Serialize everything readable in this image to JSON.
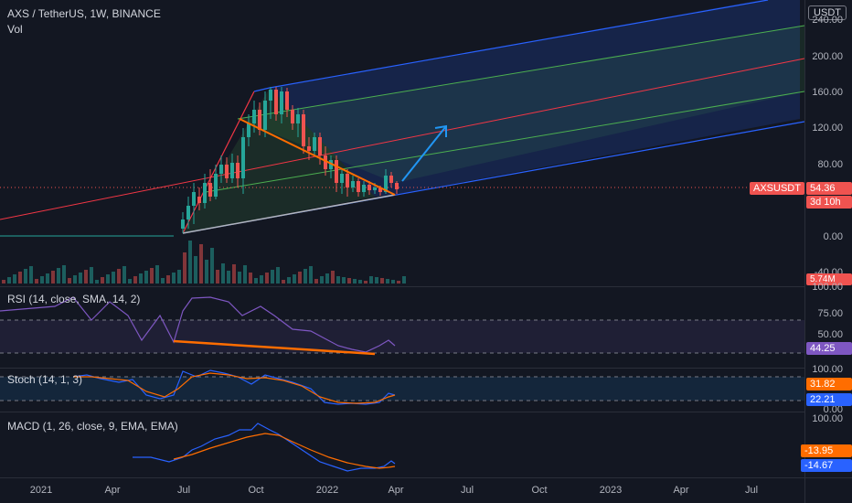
{
  "header": {
    "symbol": "AXS / TetherUS, 1W, BINANCE",
    "vol_label": "Vol"
  },
  "currency_badge": "USDT",
  "price_axis": [
    "240.00",
    "200.00",
    "160.00",
    "120.00",
    "80.00",
    "0.00",
    "-40.00"
  ],
  "price_tag": {
    "symbol": "AXSUSDT",
    "price": "54.36",
    "countdown": "3d 10h"
  },
  "volume_tag": "5.74M",
  "rsi": {
    "title": "RSI (14, close, SMA, 14, 2)",
    "axis": [
      "100.00",
      "75.00",
      "50.00"
    ],
    "value": "44.25"
  },
  "stoch": {
    "title": "Stoch (14, 1, 3)",
    "axis": [
      "100.00",
      "0.00"
    ],
    "values": [
      "31.82",
      "22.21"
    ]
  },
  "macd": {
    "title": "MACD (1, 26, close, 9, EMA, EMA)",
    "axis": [
      "100.00"
    ],
    "values": [
      "-13.95",
      "-14.67"
    ]
  },
  "time_axis": [
    "2021",
    "Apr",
    "Jul",
    "Oct",
    "2022",
    "Apr",
    "Jul",
    "Oct",
    "2023",
    "Apr",
    "Jul"
  ],
  "colors": {
    "background": "#131722",
    "up": "#26a69a",
    "down": "#ef5350",
    "channel_blue": "#2962ff",
    "channel_green": "#4caf50",
    "median_red": "#f23645",
    "trend_orange": "#ff6d00",
    "rsi_line": "#7e57c2",
    "arrow": "#2196f3"
  }
}
